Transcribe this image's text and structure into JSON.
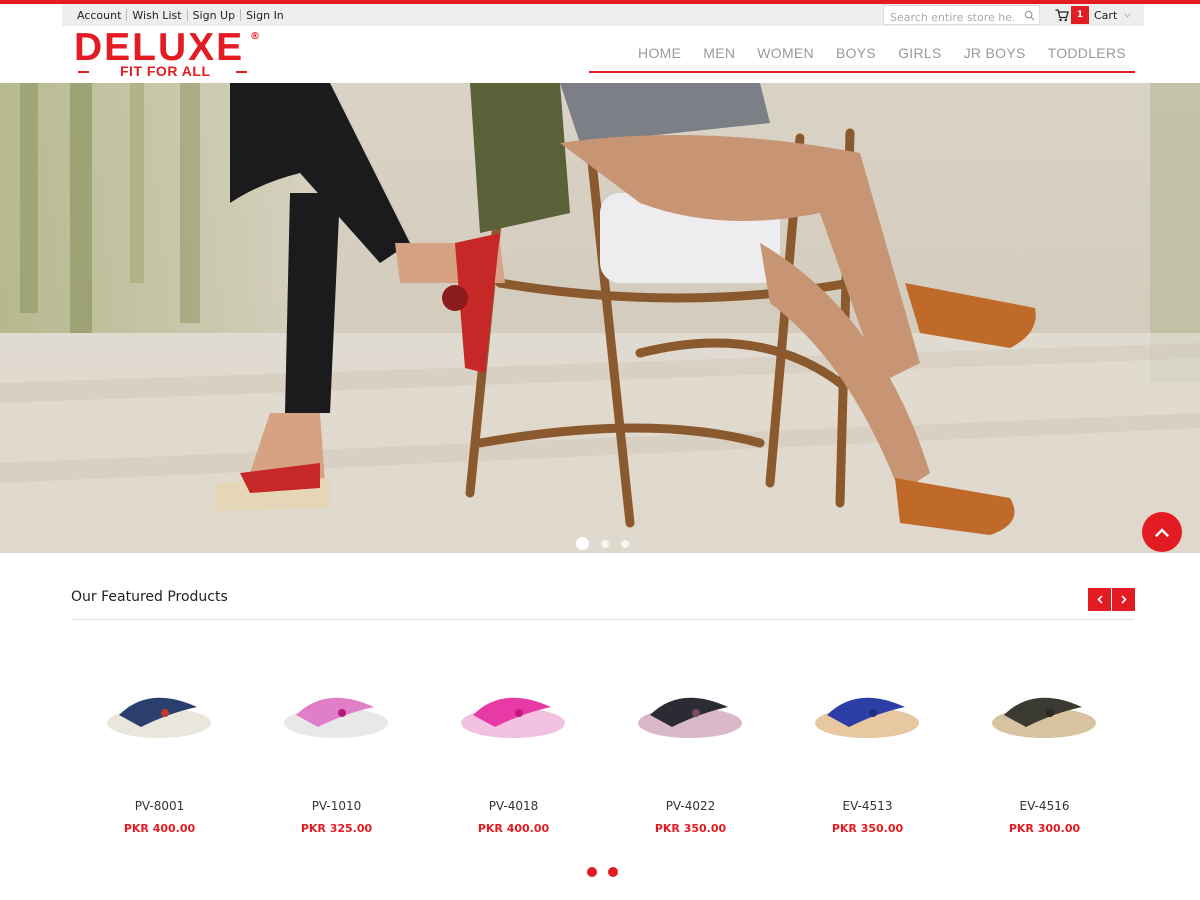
{
  "colors": {
    "accent": "#e31b23",
    "nav_text": "#9a9a9a",
    "topbar_bg": "#eeeeee"
  },
  "toplinks": [
    {
      "label": "Account"
    },
    {
      "label": "Wish List"
    },
    {
      "label": "Sign Up"
    },
    {
      "label": "Sign In"
    }
  ],
  "search": {
    "placeholder": "Search entire store he...",
    "icon": "search-icon"
  },
  "cart": {
    "count": "1",
    "label": "Cart",
    "icon": "cart-icon"
  },
  "logo": {
    "brand": "DELUXE",
    "registered": "®",
    "tagline": "FIT FOR ALL"
  },
  "nav": [
    {
      "label": "HOME"
    },
    {
      "label": "MEN"
    },
    {
      "label": "WOMEN"
    },
    {
      "label": "BOYS"
    },
    {
      "label": "GIRLS"
    },
    {
      "label": "JR BOYS"
    },
    {
      "label": "TODDLERS"
    }
  ],
  "hero": {
    "slide_count": 3,
    "active_slide": 1
  },
  "featured": {
    "title": "Our Featured Products",
    "prev_icon": "chevron-left-icon",
    "next_icon": "chevron-right-icon",
    "products": [
      {
        "code": "PV-8001",
        "price": "PKR 400.00",
        "strap": "#2a3f6e",
        "sole": "#e9e6dc",
        "accent": "#c0392b"
      },
      {
        "code": "PV-1010",
        "price": "PKR 325.00",
        "strap": "#e07fc8",
        "sole": "#e8e8ea",
        "accent": "#b3197a"
      },
      {
        "code": "PV-4018",
        "price": "PKR 400.00",
        "strap": "#e83aa6",
        "sole": "#f2c0e0",
        "accent": "#c2187e"
      },
      {
        "code": "PV-4022",
        "price": "PKR 350.00",
        "strap": "#2b2b33",
        "sole": "#d9b8c8",
        "accent": "#7a4a66"
      },
      {
        "code": "EV-4513",
        "price": "PKR 350.00",
        "strap": "#2b3fa6",
        "sole": "#e8c8a0",
        "accent": "#1e2f80"
      },
      {
        "code": "EV-4516",
        "price": "PKR 300.00",
        "strap": "#3a3a32",
        "sole": "#d8c3a0",
        "accent": "#2a2a24"
      }
    ],
    "page_count": 2
  },
  "scroll_top_icon": "chevron-up-icon"
}
